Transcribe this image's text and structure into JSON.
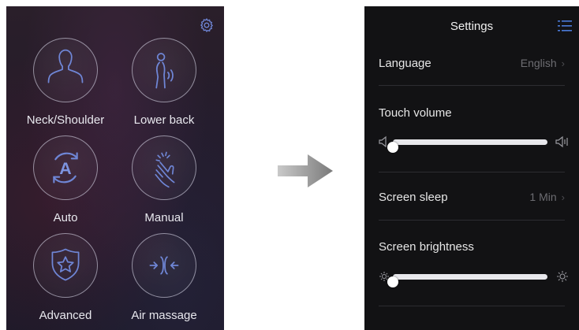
{
  "menu": {
    "settings_icon": "gear-icon",
    "items": [
      {
        "label": "Neck/Shoulder",
        "icon": "neck-shoulder-icon"
      },
      {
        "label": "Lower back",
        "icon": "lower-back-icon"
      },
      {
        "label": "Auto",
        "icon": "auto-icon"
      },
      {
        "label": "Manual",
        "icon": "manual-hand-icon"
      },
      {
        "label": "Advanced",
        "icon": "shield-star-icon"
      },
      {
        "label": "Air massage",
        "icon": "air-massage-icon"
      }
    ]
  },
  "transition": {
    "icon": "arrow-right-icon"
  },
  "settings": {
    "title": "Settings",
    "menu_icon": "list-menu-icon",
    "language": {
      "label": "Language",
      "value": "English"
    },
    "touch_volume": {
      "label": "Touch volume",
      "level": 0.0,
      "min_icon": "speaker-mute-icon",
      "max_icon": "speaker-loud-icon"
    },
    "screen_sleep": {
      "label": "Screen sleep",
      "value": "1 Min"
    },
    "screen_brightness": {
      "label": "Screen brightness",
      "level": 0.0,
      "min_icon": "sun-dim-icon",
      "max_icon": "sun-bright-icon"
    },
    "chevron": "›"
  },
  "colors": {
    "accent_blue": "#4a7bd8",
    "icon_line": "#6f86d6",
    "panel_dark": "#121214"
  }
}
